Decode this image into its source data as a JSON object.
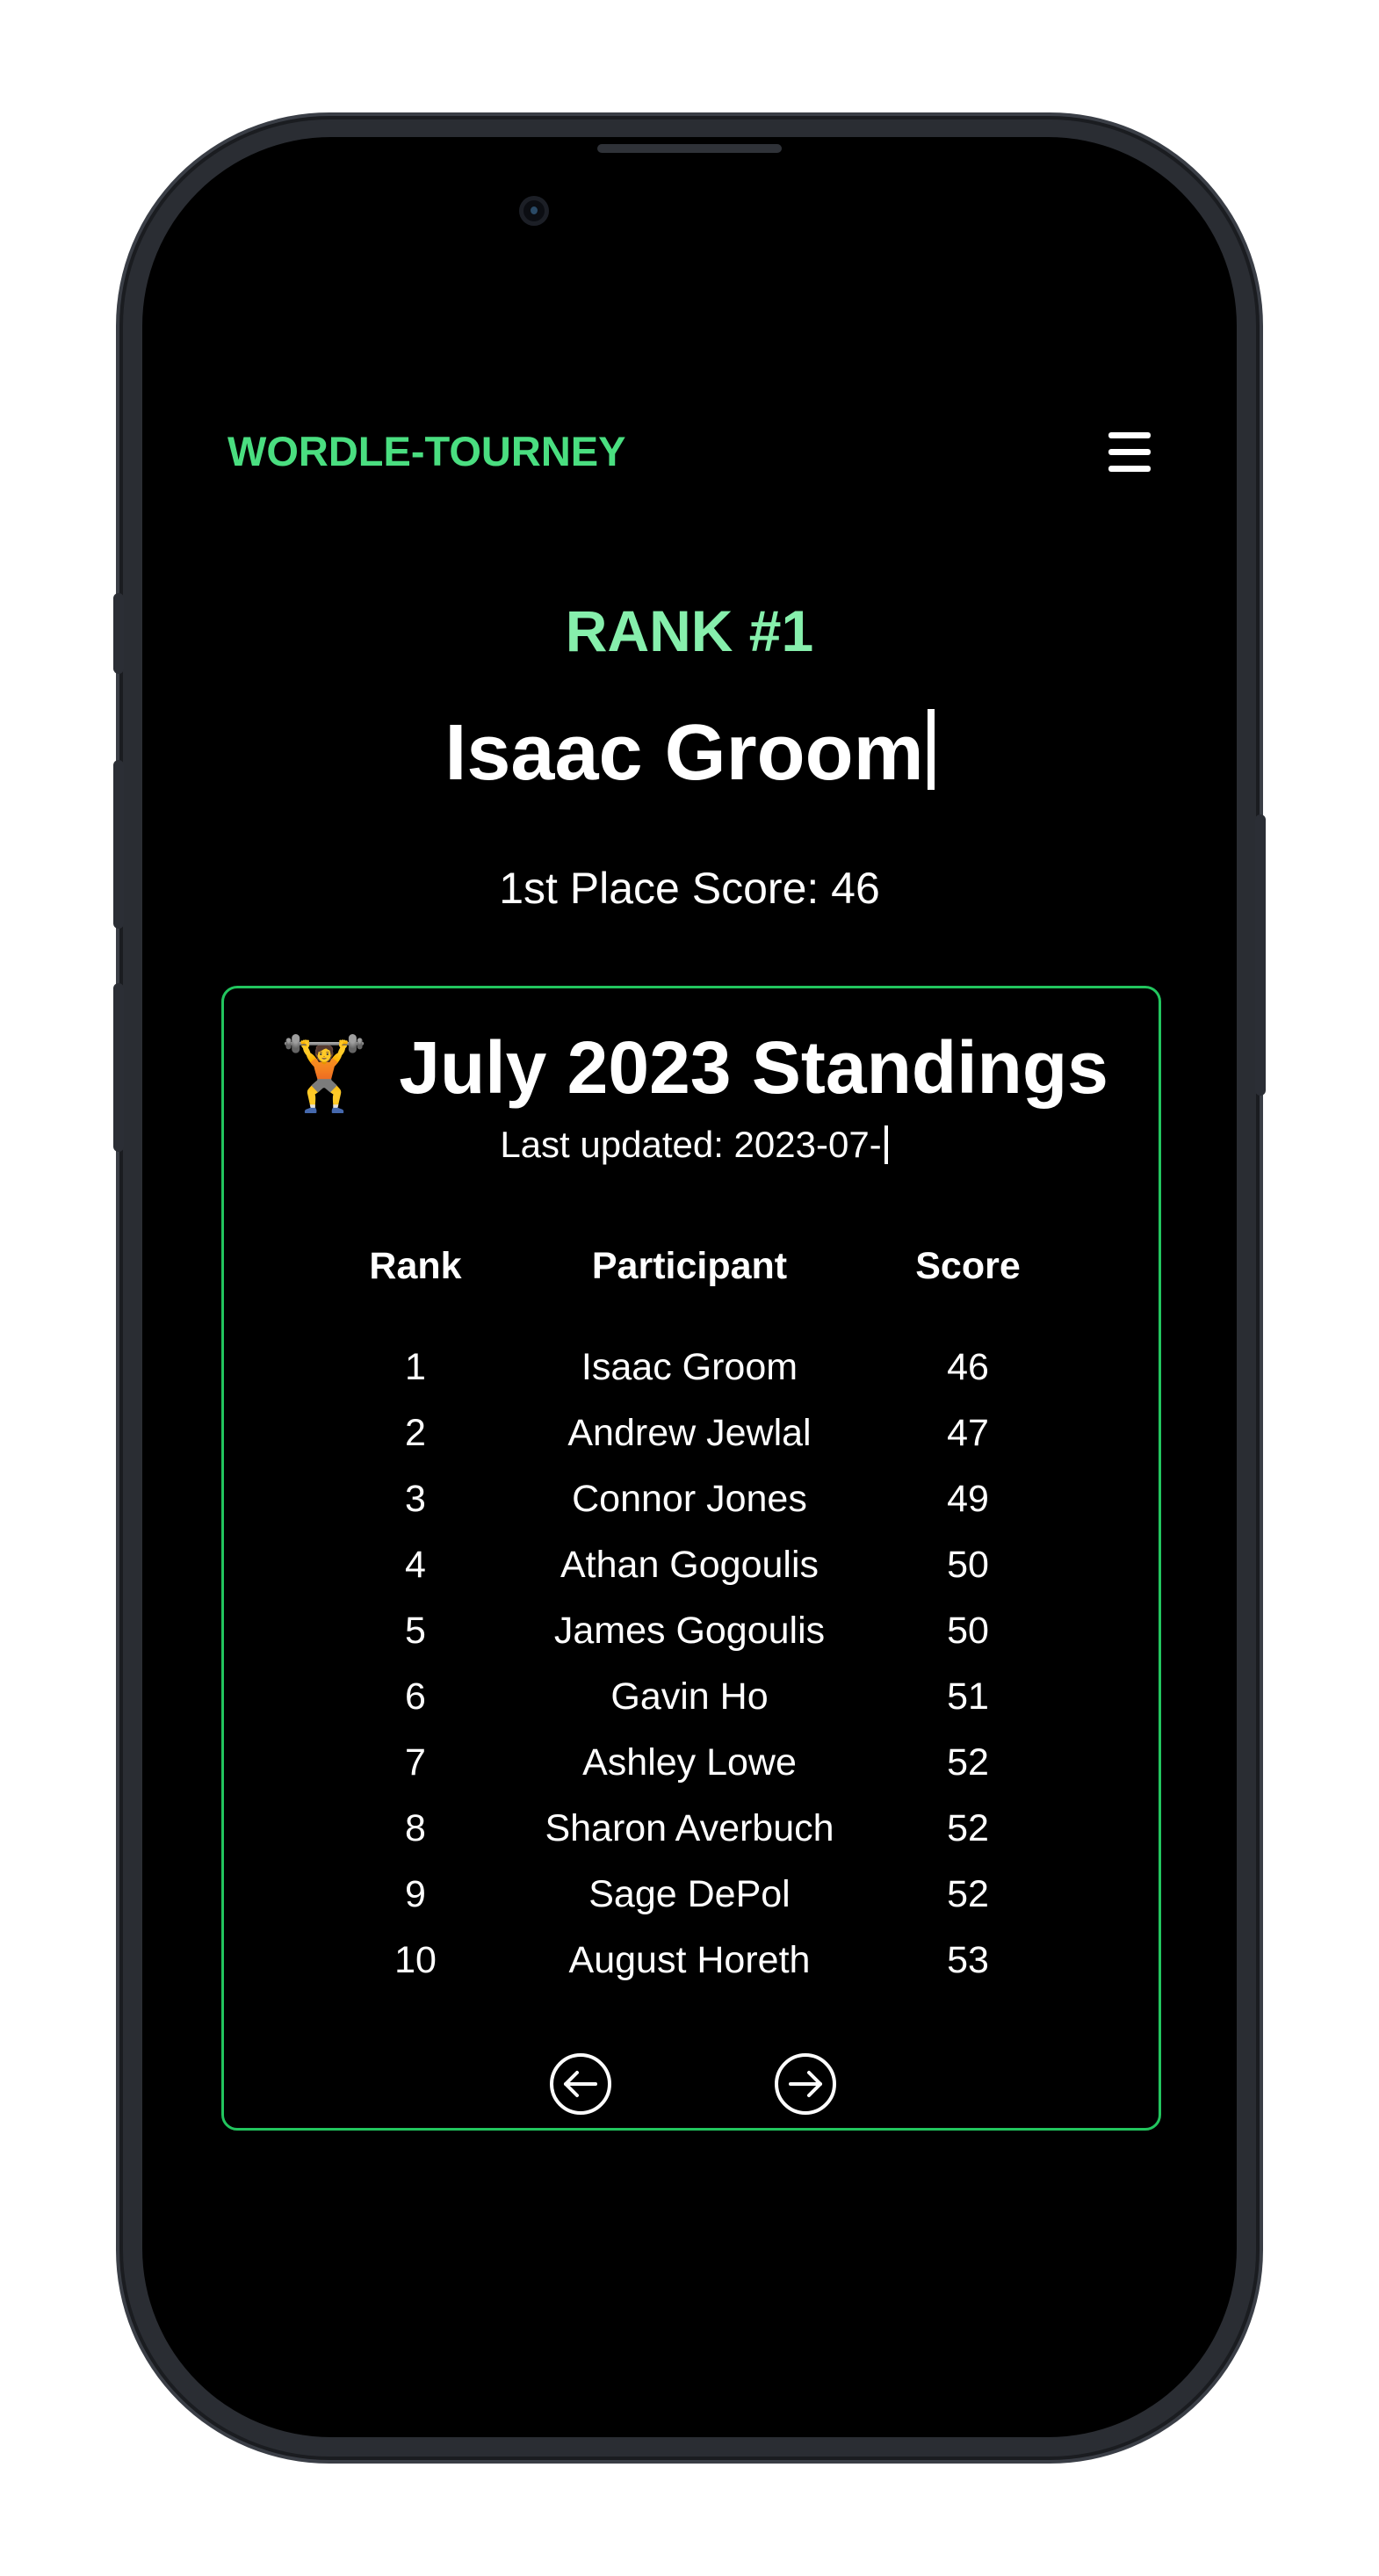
{
  "header": {
    "brand": "WORDLE-TOURNEY",
    "menu_icon": "hamburger-menu-icon"
  },
  "hero": {
    "rank_label": "RANK #1",
    "name": "Isaac Groom",
    "score_text": "1st Place Score: 46"
  },
  "standings": {
    "icon": "weight-lifter-emoji",
    "title": "July 2023 Standings",
    "updated": "Last updated: 2023-07-",
    "columns": [
      "Rank",
      "Participant",
      "Score"
    ],
    "rows": [
      {
        "rank": "1",
        "name": "Isaac Groom",
        "score": "46"
      },
      {
        "rank": "2",
        "name": "Andrew Jewlal",
        "score": "47"
      },
      {
        "rank": "3",
        "name": "Connor Jones",
        "score": "49"
      },
      {
        "rank": "4",
        "name": "Athan Gogoulis",
        "score": "50"
      },
      {
        "rank": "5",
        "name": "James Gogoulis",
        "score": "50"
      },
      {
        "rank": "6",
        "name": "Gavin Ho",
        "score": "51"
      },
      {
        "rank": "7",
        "name": "Ashley Lowe",
        "score": "52"
      },
      {
        "rank": "8",
        "name": "Sharon Averbuch",
        "score": "52"
      },
      {
        "rank": "9",
        "name": "Sage DePol",
        "score": "52"
      },
      {
        "rank": "10",
        "name": "August Horeth",
        "score": "53"
      }
    ],
    "prev_icon": "arrow-left-circle-icon",
    "next_icon": "arrow-right-circle-icon"
  },
  "colors": {
    "accent": "#4ade80",
    "rank_label": "#86efac",
    "card_border": "#22c55e",
    "background": "#000000",
    "text": "#ffffff"
  }
}
